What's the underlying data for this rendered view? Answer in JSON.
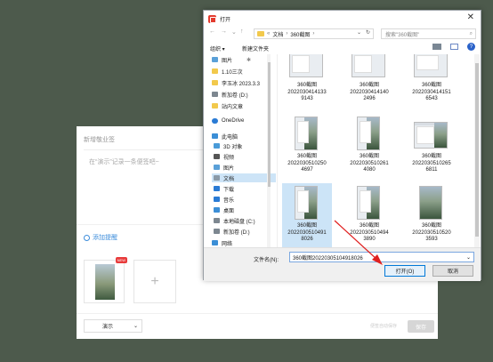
{
  "background_app": {
    "title": "新增敬业签",
    "placeholder": "在“演示”记录一条便签吧~",
    "reminder_label": "添加提醒",
    "badge": "NEW",
    "add_symbol": "+",
    "type_select": "演示",
    "autosave_hint": "便签自动保存",
    "save_label": "保存"
  },
  "dialog": {
    "title": "打开",
    "close": "✕",
    "nav_back": "←",
    "nav_forward": "→",
    "nav_dropdown": "⌄",
    "nav_up": "↑",
    "breadcrumb": [
      "«",
      "文档",
      "›",
      "360截图",
      "›"
    ],
    "address_controls": [
      "⌄",
      "↻"
    ],
    "search_placeholder": "搜索\"360截图\"",
    "search_icon": "search-icon",
    "toolbar": {
      "organize": "组织 ▾",
      "new_folder": "新建文件夹",
      "help": "?"
    },
    "nav_items": [
      {
        "label": "图片",
        "pin": "✱"
      },
      {
        "label": "1.10三次"
      },
      {
        "label": "李玉冰 2023.3.3"
      },
      {
        "label": "新加卷 (D:)"
      },
      {
        "label": "站内文章"
      },
      {
        "label": "OneDrive"
      },
      {
        "label": "此电脑"
      },
      {
        "label": "3D 对象"
      },
      {
        "label": "视频"
      },
      {
        "label": "图片"
      },
      {
        "label": "文档"
      },
      {
        "label": "下载"
      },
      {
        "label": "音乐"
      },
      {
        "label": "桌面"
      },
      {
        "label": "本地磁盘 (C:)"
      },
      {
        "label": "新加卷 (D:)"
      },
      {
        "label": "网络"
      }
    ],
    "files": [
      {
        "line1": "360截图",
        "line2": "2022030414133",
        "line3": "9143"
      },
      {
        "line1": "360截图",
        "line2": "2022030414140",
        "line3": "2496"
      },
      {
        "line1": "360截图",
        "line2": "2022030414151",
        "line3": "6543"
      },
      {
        "line1": "360截图",
        "line2": "2022030510250",
        "line3": "4697"
      },
      {
        "line1": "360截图",
        "line2": "2022030510261",
        "line3": "4080"
      },
      {
        "line1": "360截图",
        "line2": "2022030510265",
        "line3": "6811"
      },
      {
        "line1": "360截图",
        "line2": "2022030510491",
        "line3": "8026"
      },
      {
        "line1": "360截图",
        "line2": "2022030510494",
        "line3": "3890"
      },
      {
        "line1": "360截图",
        "line2": "2022030510520",
        "line3": "3593"
      }
    ],
    "filename_label": "文件名(N):",
    "filename_value": "360截图20220305104918026",
    "filename_dropdown": "⌄",
    "open_label": "打开(O)",
    "cancel_label": "取消"
  }
}
